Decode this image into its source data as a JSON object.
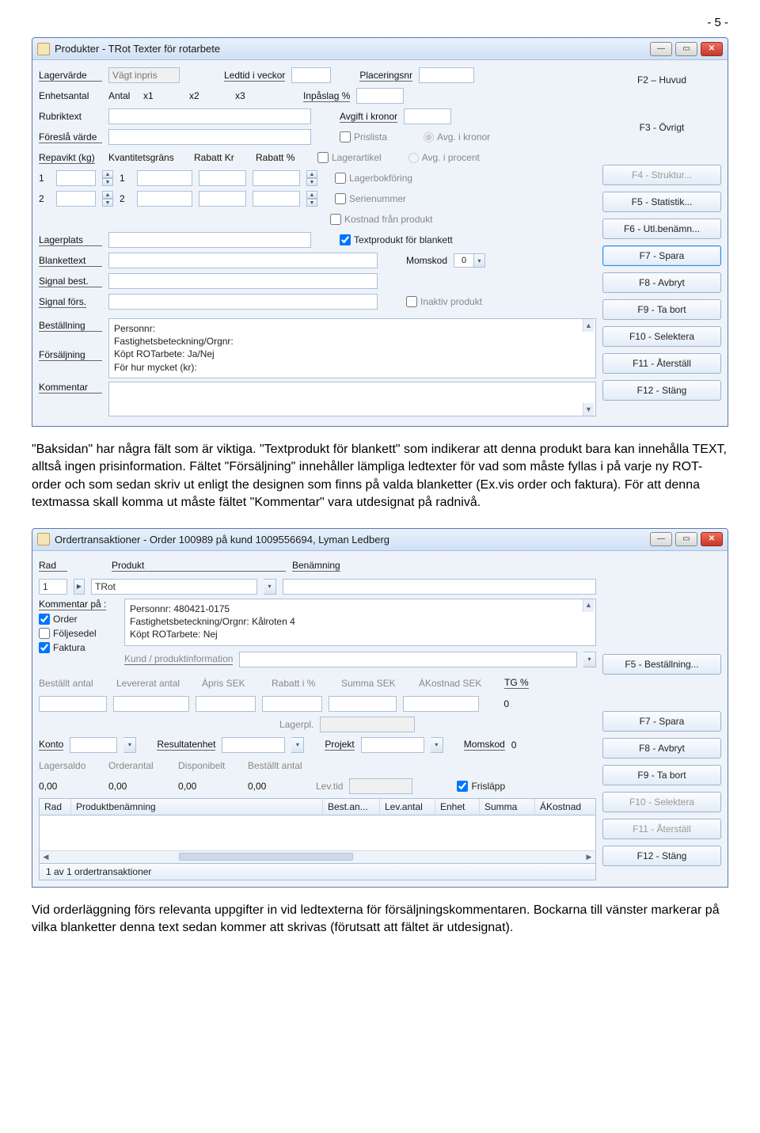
{
  "page_number": "- 5 -",
  "paragraph1": "\"Baksidan\" har några fält som är viktiga. \"Textprodukt för blankett\" som indikerar att denna produkt bara kan innehålla TEXT, alltså ingen prisinformation. Fältet \"Försäljning\" innehåller lämpliga ledtexter för vad som måste fyllas i på varje ny ROT-order och som sedan skriv ut enligt the designen som finns på valda blanketter (Ex.vis order och faktura). För att denna textmassa skall komma ut måste fältet \"Kommentar\" vara utdesignat på radnivå.",
  "paragraph2": "Vid orderläggning förs relevanta uppgifter in vid ledtexterna för försäljningskommentaren. Bockarna till vänster markerar på vilka blanketter denna text sedan kommer att skrivas (förutsatt att fältet är utdesignat).",
  "win1": {
    "title": "Produkter - TRot Texter för rotarbete",
    "labels": {
      "lagervarde": "Lagervärde",
      "vagt_inpris": "Vägt inpris",
      "ledtid": "Ledtid i veckor",
      "placeringsnr": "Placeringsnr",
      "enhetsantal": "Enhetsantal",
      "antal": "Antal",
      "x1": "x1",
      "x2": "x2",
      "x3": "x3",
      "inpaslag": "Inpåslag %",
      "rubriktext": "Rubriktext",
      "avgift": "Avgift i kronor",
      "foresla": "Föreslå värde",
      "prislista": "Prislista",
      "avg_kronor": "Avg. i kronor",
      "repavikt": "Repavikt (kg)",
      "kvantitetsgrans": "Kvantitetsgräns",
      "rabatt_kr": "Rabatt Kr",
      "rabatt_pct": "Rabatt %",
      "lagerartikel": "Lagerartikel",
      "avg_procent": "Avg. i procent",
      "n1": "1",
      "n2": "2",
      "lagerbokforing": "Lagerbokföring",
      "serienummer": "Serienummer",
      "kostnad_produkt": "Kostnad från produkt",
      "textprodukt": "Textprodukt för blankett",
      "lagerplats": "Lagerplats",
      "blanketttext": "Blankettext",
      "momskod": "Momskod",
      "momskod_val": "0",
      "signal_best": "Signal best.",
      "signal_fors": "Signal förs.",
      "inaktiv": "Inaktiv produkt",
      "bestallning": "Beställning",
      "forsaljning": "Försäljning",
      "kommentar": "Kommentar"
    },
    "forsaljning_text": {
      "l1": "Personnr:",
      "l2": "Fastighetsbeteckning/Orgnr:",
      "l3": "Köpt ROTarbete: Ja/Nej",
      "l4": "För hur mycket (kr):"
    },
    "side": {
      "f2": "F2 – Huvud",
      "f3": "F3 - Övrigt",
      "f4": "F4 - Struktur...",
      "f5": "F5 - Statistik...",
      "f6": "F6 - Utl.benämn...",
      "f7": "F7 - Spara",
      "f8": "F8 - Avbryt",
      "f9": "F9 - Ta bort",
      "f10": "F10 - Selektera",
      "f11": "F11 - Återställ",
      "f12": "F12 - Stäng"
    }
  },
  "win2": {
    "title": "Ordertransaktioner - Order 100989 på kund 1009556694, Lyman Ledberg",
    "labels": {
      "rad": "Rad",
      "rad_val": "1",
      "produkt": "Produkt",
      "produkt_val": "TRot",
      "benamning": "Benämning",
      "kommentar_pa": "Kommentar på :",
      "order": "Order",
      "foljesedel": "Följesedel",
      "faktura": "Faktura",
      "kund_info": "Kund / produktinformation",
      "bestallt": "Beställt antal",
      "levererat": "Levererat antal",
      "apris": "Ápris SEK",
      "rabatt_i": "Rabatt i %",
      "summa": "Summa SEK",
      "akostnad": "ÁKostnad SEK",
      "tg": "TG %",
      "tg_val": "0",
      "lagerpl": "Lagerpl.",
      "konto": "Konto",
      "resultatenhet": "Resultatenhet",
      "projekt": "Projekt",
      "momskod": "Momskod",
      "momskod_val": "0",
      "lagersaldo": "Lagersaldo",
      "orderantal": "Orderantal",
      "disponibelt": "Disponibelt",
      "bestallt_antal": "Beställt antal",
      "zero": "0,00",
      "levtid": "Lev.tid",
      "frislapp": "Frisläpp"
    },
    "kommentar_text": {
      "l1": "Personnr: 480421-0175",
      "l2": "Fastighetsbeteckning/Orgnr: Kålroten 4",
      "l3": "Köpt ROTarbete: Nej"
    },
    "table": {
      "rad": "Rad",
      "produktbenamning": "Produktbenämning",
      "best_an": "Best.an...",
      "lev_antal": "Lev.antal",
      "enhet": "Enhet",
      "summa": "Summa",
      "akostnad": "ÁKostnad"
    },
    "status": "1 av 1 ordertransaktioner",
    "side": {
      "f5": "F5 - Beställning...",
      "f7": "F7 - Spara",
      "f8": "F8 - Avbryt",
      "f9": "F9 - Ta bort",
      "f10": "F10 - Selektera",
      "f11": "F11 - Återställ",
      "f12": "F12 - Stäng"
    }
  }
}
